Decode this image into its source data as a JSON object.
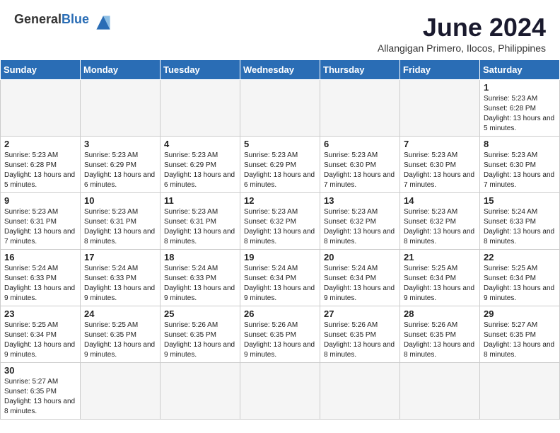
{
  "header": {
    "logo_general": "General",
    "logo_blue": "Blue",
    "month_title": "June 2024",
    "location": "Allangigan Primero, Ilocos, Philippines"
  },
  "weekdays": [
    "Sunday",
    "Monday",
    "Tuesday",
    "Wednesday",
    "Thursday",
    "Friday",
    "Saturday"
  ],
  "weeks": [
    [
      {
        "day": "",
        "empty": true
      },
      {
        "day": "",
        "empty": true
      },
      {
        "day": "",
        "empty": true
      },
      {
        "day": "",
        "empty": true
      },
      {
        "day": "",
        "empty": true
      },
      {
        "day": "",
        "empty": true
      },
      {
        "day": "1",
        "sunrise": "5:23 AM",
        "sunset": "6:28 PM",
        "daylight": "13 hours and 5 minutes."
      }
    ],
    [
      {
        "day": "2",
        "sunrise": "5:23 AM",
        "sunset": "6:28 PM",
        "daylight": "13 hours and 5 minutes."
      },
      {
        "day": "3",
        "sunrise": "5:23 AM",
        "sunset": "6:29 PM",
        "daylight": "13 hours and 6 minutes."
      },
      {
        "day": "4",
        "sunrise": "5:23 AM",
        "sunset": "6:29 PM",
        "daylight": "13 hours and 6 minutes."
      },
      {
        "day": "5",
        "sunrise": "5:23 AM",
        "sunset": "6:29 PM",
        "daylight": "13 hours and 6 minutes."
      },
      {
        "day": "6",
        "sunrise": "5:23 AM",
        "sunset": "6:30 PM",
        "daylight": "13 hours and 7 minutes."
      },
      {
        "day": "7",
        "sunrise": "5:23 AM",
        "sunset": "6:30 PM",
        "daylight": "13 hours and 7 minutes."
      },
      {
        "day": "8",
        "sunrise": "5:23 AM",
        "sunset": "6:30 PM",
        "daylight": "13 hours and 7 minutes."
      }
    ],
    [
      {
        "day": "9",
        "sunrise": "5:23 AM",
        "sunset": "6:31 PM",
        "daylight": "13 hours and 7 minutes."
      },
      {
        "day": "10",
        "sunrise": "5:23 AM",
        "sunset": "6:31 PM",
        "daylight": "13 hours and 8 minutes."
      },
      {
        "day": "11",
        "sunrise": "5:23 AM",
        "sunset": "6:31 PM",
        "daylight": "13 hours and 8 minutes."
      },
      {
        "day": "12",
        "sunrise": "5:23 AM",
        "sunset": "6:32 PM",
        "daylight": "13 hours and 8 minutes."
      },
      {
        "day": "13",
        "sunrise": "5:23 AM",
        "sunset": "6:32 PM",
        "daylight": "13 hours and 8 minutes."
      },
      {
        "day": "14",
        "sunrise": "5:23 AM",
        "sunset": "6:32 PM",
        "daylight": "13 hours and 8 minutes."
      },
      {
        "day": "15",
        "sunrise": "5:24 AM",
        "sunset": "6:33 PM",
        "daylight": "13 hours and 8 minutes."
      }
    ],
    [
      {
        "day": "16",
        "sunrise": "5:24 AM",
        "sunset": "6:33 PM",
        "daylight": "13 hours and 9 minutes."
      },
      {
        "day": "17",
        "sunrise": "5:24 AM",
        "sunset": "6:33 PM",
        "daylight": "13 hours and 9 minutes."
      },
      {
        "day": "18",
        "sunrise": "5:24 AM",
        "sunset": "6:33 PM",
        "daylight": "13 hours and 9 minutes."
      },
      {
        "day": "19",
        "sunrise": "5:24 AM",
        "sunset": "6:34 PM",
        "daylight": "13 hours and 9 minutes."
      },
      {
        "day": "20",
        "sunrise": "5:24 AM",
        "sunset": "6:34 PM",
        "daylight": "13 hours and 9 minutes."
      },
      {
        "day": "21",
        "sunrise": "5:25 AM",
        "sunset": "6:34 PM",
        "daylight": "13 hours and 9 minutes."
      },
      {
        "day": "22",
        "sunrise": "5:25 AM",
        "sunset": "6:34 PM",
        "daylight": "13 hours and 9 minutes."
      }
    ],
    [
      {
        "day": "23",
        "sunrise": "5:25 AM",
        "sunset": "6:34 PM",
        "daylight": "13 hours and 9 minutes."
      },
      {
        "day": "24",
        "sunrise": "5:25 AM",
        "sunset": "6:35 PM",
        "daylight": "13 hours and 9 minutes."
      },
      {
        "day": "25",
        "sunrise": "5:26 AM",
        "sunset": "6:35 PM",
        "daylight": "13 hours and 9 minutes."
      },
      {
        "day": "26",
        "sunrise": "5:26 AM",
        "sunset": "6:35 PM",
        "daylight": "13 hours and 9 minutes."
      },
      {
        "day": "27",
        "sunrise": "5:26 AM",
        "sunset": "6:35 PM",
        "daylight": "13 hours and 8 minutes."
      },
      {
        "day": "28",
        "sunrise": "5:26 AM",
        "sunset": "6:35 PM",
        "daylight": "13 hours and 8 minutes."
      },
      {
        "day": "29",
        "sunrise": "5:27 AM",
        "sunset": "6:35 PM",
        "daylight": "13 hours and 8 minutes."
      }
    ],
    [
      {
        "day": "30",
        "sunrise": "5:27 AM",
        "sunset": "6:35 PM",
        "daylight": "13 hours and 8 minutes."
      },
      {
        "day": "",
        "empty": true
      },
      {
        "day": "",
        "empty": true
      },
      {
        "day": "",
        "empty": true
      },
      {
        "day": "",
        "empty": true
      },
      {
        "day": "",
        "empty": true
      },
      {
        "day": "",
        "empty": true
      }
    ]
  ]
}
